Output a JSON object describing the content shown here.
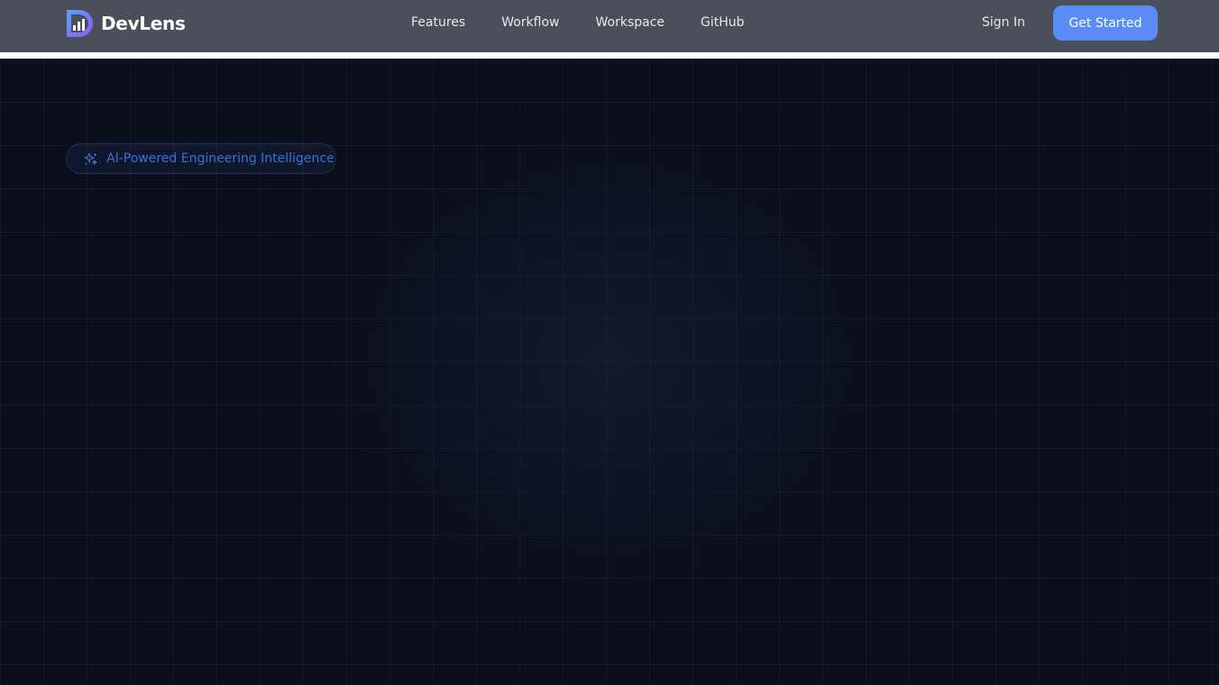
{
  "navbar": {
    "brand_name": "DevLens",
    "links": [
      "Features",
      "Workflow",
      "Workspace",
      "GitHub"
    ],
    "sign_in_label": "Sign In",
    "cta_label": "Get Started"
  },
  "hero": {
    "badge_text": "AI-Powered Engineering Intelligence"
  },
  "icons": {
    "logo": "devlens-logo-icon",
    "badge": "sparkles-icon"
  },
  "colors": {
    "navbar_background": "#4a4f59",
    "cta_background": "#5b8cf6",
    "hero_background": "#0b0f1a",
    "badge_text": "#3d6fd2"
  }
}
